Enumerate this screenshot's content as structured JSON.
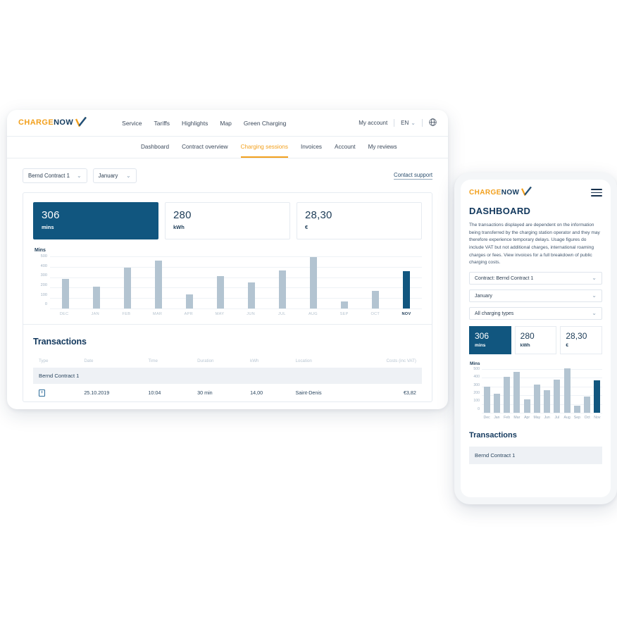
{
  "brand": {
    "name_part1": "CHARGE",
    "name_part2": "NOW",
    "checkmark_icon": "check-mark-icon",
    "orange": "#f2a01d",
    "navy": "#123a5e",
    "primary": "#11567f"
  },
  "desktop": {
    "topnav": {
      "items": [
        {
          "label": "Service"
        },
        {
          "label": "Tariffs"
        },
        {
          "label": "Highlights"
        },
        {
          "label": "Map"
        },
        {
          "label": "Green Charging"
        }
      ],
      "my_account": "My account",
      "language": "EN",
      "globe_icon": "globe-icon",
      "chevron_icon": "chevron-down-icon"
    },
    "subnav": {
      "items": [
        {
          "label": "Dashboard",
          "active": false
        },
        {
          "label": "Contract overview",
          "active": false
        },
        {
          "label": "Charging sessions",
          "active": true
        },
        {
          "label": "Invoices",
          "active": false
        },
        {
          "label": "Account",
          "active": false
        },
        {
          "label": "My reviews",
          "active": false
        }
      ]
    },
    "filters": {
      "contract": "Bernd Contract 1",
      "month": "January",
      "contact_support": "Contact support"
    },
    "kpis": [
      {
        "value": "306",
        "unit": "mins",
        "highlight": true
      },
      {
        "value": "280",
        "unit": "kWh",
        "highlight": false
      },
      {
        "value": "28,30",
        "unit": "€",
        "highlight": false
      }
    ],
    "transactions": {
      "title": "Transactions",
      "columns": [
        "Type",
        "Date",
        "Time",
        "Duration",
        "kWh",
        "Location",
        "Costs (inc VAT)"
      ],
      "group_label": "Bernd Contract 1",
      "rows": [
        {
          "type_icon": "charging-plug-icon",
          "date": "25.10.2019",
          "time": "10:04",
          "duration": "30 min",
          "kwh": "14,00",
          "location": "Saint-Denis",
          "cost": "€3,82"
        }
      ]
    }
  },
  "phone": {
    "menu_icon": "hamburger-menu-icon",
    "title": "DASHBOARD",
    "description": "The transactions displayed are dependent on the information being transferred by the charging station operator and they may therefore experience temporary delays. Usage figures do include VAT but not additional charges, international roaming charges or fees. View invoices for a full breakdown of public charging costs.",
    "selects": [
      {
        "label": "Contract: Bernd Contract 1"
      },
      {
        "label": "January"
      },
      {
        "label": "All charging types"
      }
    ],
    "kpis": [
      {
        "value": "306",
        "unit": "mins",
        "highlight": true
      },
      {
        "value": "280",
        "unit": "kWh",
        "highlight": false
      },
      {
        "value": "28,30",
        "unit": "€",
        "highlight": false
      }
    ],
    "transactions": {
      "title": "Transactions",
      "group_label": "Bernd Contract 1"
    }
  },
  "chart_data": [
    {
      "type": "bar",
      "id": "desktop-monthly-minutes",
      "title": "",
      "ylabel": "Mins",
      "xlabel": "",
      "categories": [
        "DEC",
        "JAN",
        "FEB",
        "MAR",
        "APR",
        "MAY",
        "JUN",
        "JUL",
        "AUG",
        "SEP",
        "OCT",
        "NOV"
      ],
      "values": [
        285,
        208,
        395,
        462,
        135,
        310,
        247,
        367,
        495,
        65,
        172,
        360
      ],
      "highlight_index": 11,
      "yticks": [
        500,
        400,
        300,
        200,
        100,
        0
      ],
      "ylim": [
        0,
        500
      ],
      "grid": true,
      "legend": "none",
      "bar_color": "#b3c4d1",
      "highlight_color": "#11567f"
    },
    {
      "type": "bar",
      "id": "mobile-monthly-minutes",
      "title": "",
      "ylabel": "Mins",
      "xlabel": "",
      "categories": [
        "Dec",
        "Jan",
        "Feb",
        "Mar",
        "Apr",
        "May",
        "Jun",
        "Jul",
        "Aug",
        "Sep",
        "Oct",
        "Nov"
      ],
      "values": [
        300,
        220,
        408,
        468,
        150,
        325,
        258,
        378,
        505,
        82,
        188,
        370
      ],
      "highlight_index": 11,
      "yticks": [
        500,
        400,
        300,
        200,
        100,
        0
      ],
      "ylim": [
        0,
        500
      ],
      "grid": true,
      "legend": "none",
      "bar_color": "#b3c4d1",
      "highlight_color": "#11567f"
    }
  ]
}
